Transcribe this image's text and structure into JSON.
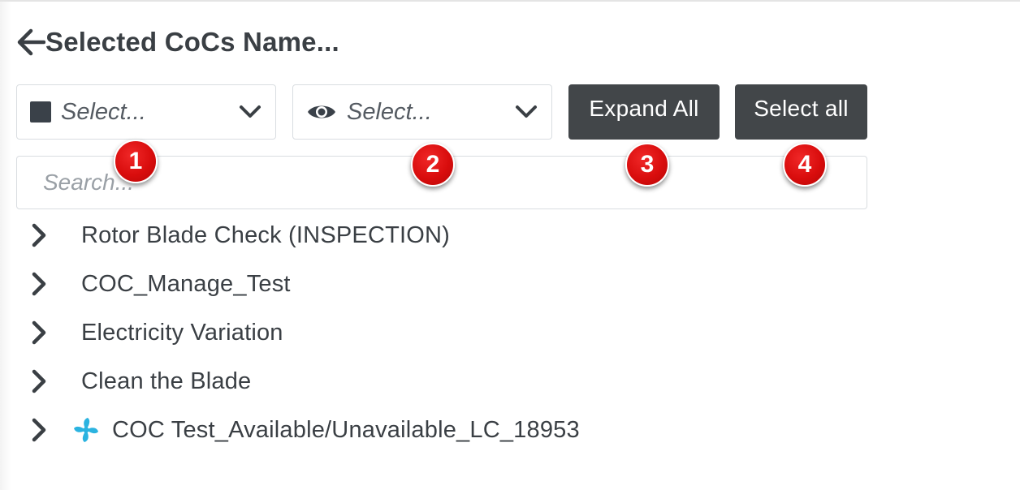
{
  "header": {
    "title": "Selected CoCs Name...",
    "back_icon": "arrow-left-icon"
  },
  "filters": {
    "select_1": {
      "placeholder": "Select...",
      "icon": "square-icon"
    },
    "select_2": {
      "placeholder": "Select...",
      "icon": "eye-icon"
    }
  },
  "buttons": {
    "expand_all": "Expand All",
    "select_all": "Select all"
  },
  "search": {
    "placeholder": "Search..."
  },
  "badges": [
    "1",
    "2",
    "3",
    "4"
  ],
  "tree": {
    "items": [
      {
        "label": "Rotor Blade Check (INSPECTION)"
      },
      {
        "label": "COC_Manage_Test"
      },
      {
        "label": "Electricity Variation"
      },
      {
        "label": "Clean the Blade"
      },
      {
        "label": "COC Test_Available/Unavailable_LC_18953",
        "icon": "fan-icon"
      }
    ]
  },
  "colors": {
    "button_bg": "#424649",
    "badge_red": "#d90d0d",
    "fan_icon": "#2bb3e0",
    "text": "#3a3f44"
  }
}
